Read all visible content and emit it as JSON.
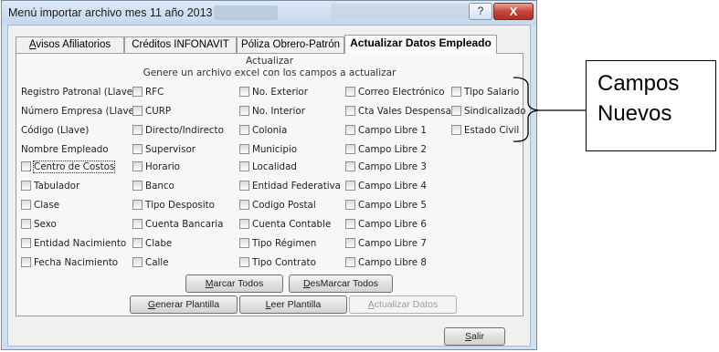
{
  "window": {
    "title": "Menú importar archivo mes 11 año 2013",
    "help_label": "?",
    "close_label": "X"
  },
  "tabs": [
    {
      "pre": "",
      "mn": "A",
      "post": "visos Afiliatorios",
      "active": false
    },
    {
      "pre": "Créditos INFONAVIT",
      "mn": "",
      "post": "",
      "active": false
    },
    {
      "pre": "Póliza Obrero-Patrón",
      "mn": "",
      "post": "",
      "active": false
    },
    {
      "pre": "Actualizar Datos Empleado",
      "mn": "",
      "post": "",
      "active": true
    }
  ],
  "panel": {
    "heading": "Actualizar",
    "subheading": "Genere un archivo excel con los campos a actualizar",
    "col1": [
      "Registro Patronal (Llave)",
      "Número Empresa (Llave)",
      "Código (Llave)",
      "Nombre Empleado"
    ],
    "col1_checks": [
      "Centro de Costos",
      "Tabulador",
      "Clase",
      "Sexo",
      "Entidad Nacimiento",
      "Fecha Nacimiento"
    ],
    "col2": [
      "RFC",
      "CURP",
      "Directo/Indirecto",
      "Supervisor",
      "Horario",
      "Banco",
      "Tipo Desposito",
      "Cuenta Bancaria",
      "Clabe",
      "Calle"
    ],
    "col3": [
      "No. Exterior",
      "No. Interior",
      "Colonia",
      "Municipio",
      "Localidad",
      "Entidad Federativa",
      "Codigo Postal",
      "Cuenta Contable",
      "Tipo Régimen",
      "Tipo Contrato"
    ],
    "col4": [
      "Correo Electrónico",
      "Cta Vales Despensa",
      "Campo Libre 1",
      "Campo Libre 2",
      "Campo Libre 3",
      "Campo Libre 4",
      "Campo Libre 5",
      "Campo Libre 6",
      "Campo Libre 7",
      "Campo Libre 8"
    ],
    "col5": [
      "Tipo Salario",
      "Sindicalizado",
      "Estado Civil"
    ]
  },
  "buttons": {
    "mark_all": {
      "pre": "",
      "mn": "M",
      "post": "arcar Todos"
    },
    "unmark_all": {
      "pre": "",
      "mn": "D",
      "post": "esMarcar Todos"
    },
    "generate": {
      "pre": "",
      "mn": "G",
      "post": "enerar Plantilla"
    },
    "read": {
      "pre": "",
      "mn": "L",
      "post": "eer Plantilla"
    },
    "update": {
      "pre": "",
      "mn": "A",
      "post": "ctualizar Datos"
    },
    "exit": {
      "pre": "",
      "mn": "S",
      "post": "alir"
    }
  },
  "callout": {
    "line1": "Campos",
    "line2": "Nuevos"
  }
}
